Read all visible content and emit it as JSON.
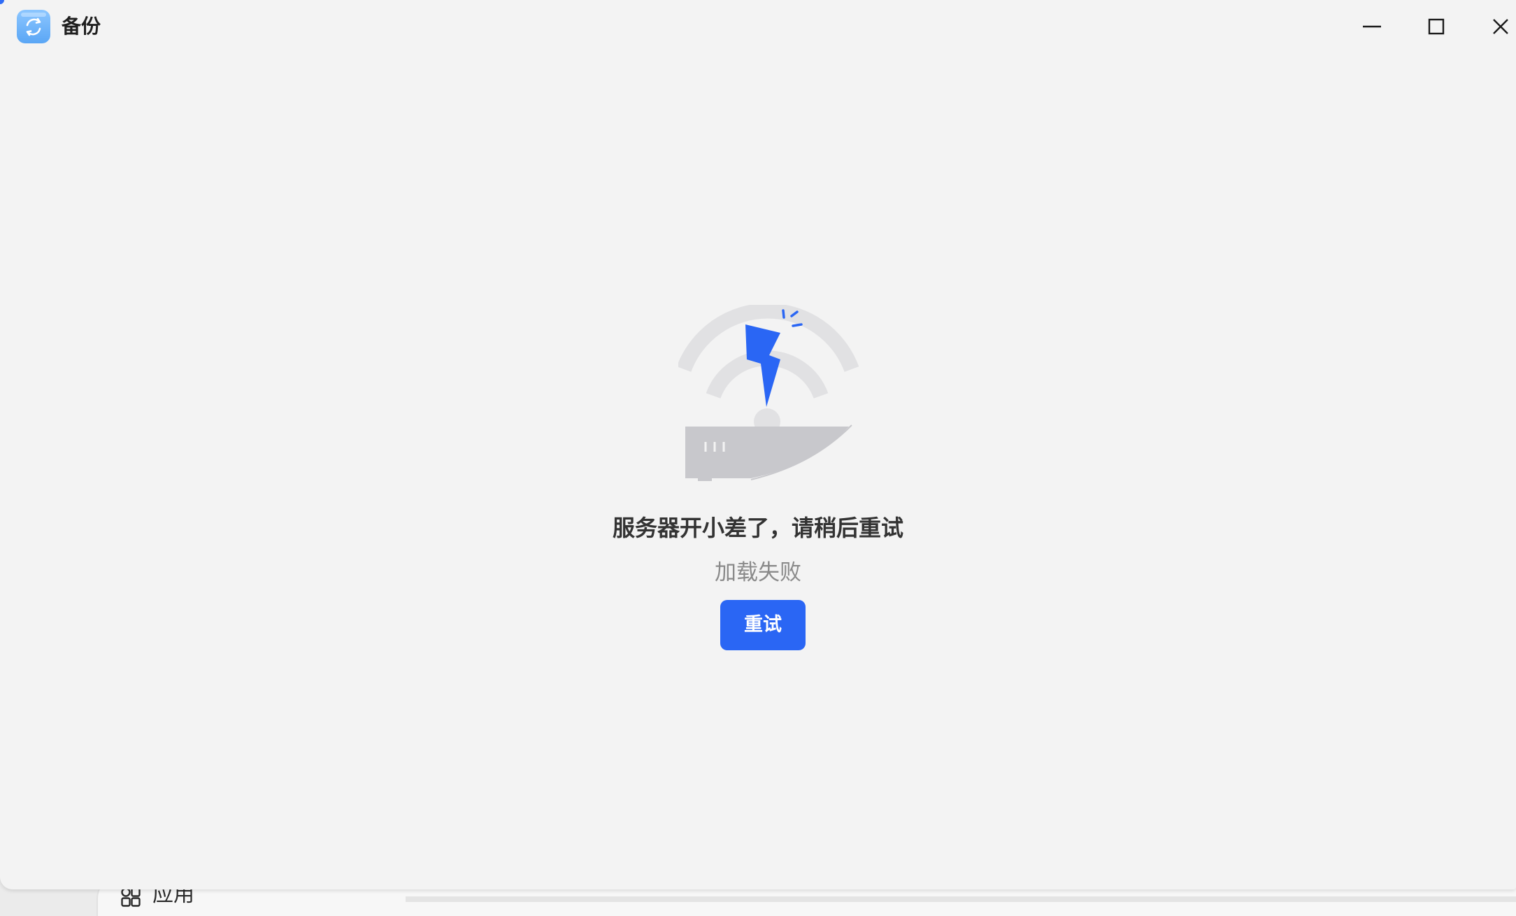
{
  "window": {
    "title": "备份",
    "app_icon": "backup-sync-icon",
    "controls": {
      "minimize_icon": "minimize-icon",
      "maximize_icon": "maximize-icon",
      "close_icon": "close-icon"
    }
  },
  "error": {
    "illustration": "broken-wifi-router-icon",
    "title": "服务器开小差了，请稍后重试",
    "subtitle": "加载失败",
    "retry_label": "重试"
  },
  "background_app": {
    "icon": "apps-grid-icon",
    "label": "应用"
  },
  "colors": {
    "accent": "#2a66f4",
    "window_bg": "#f3f3f3",
    "title_text": "#333333",
    "subtitle_text": "#8a8a8a",
    "illustration_gray": "#c8c8cc",
    "illustration_light_gray": "#e1e1e3"
  }
}
